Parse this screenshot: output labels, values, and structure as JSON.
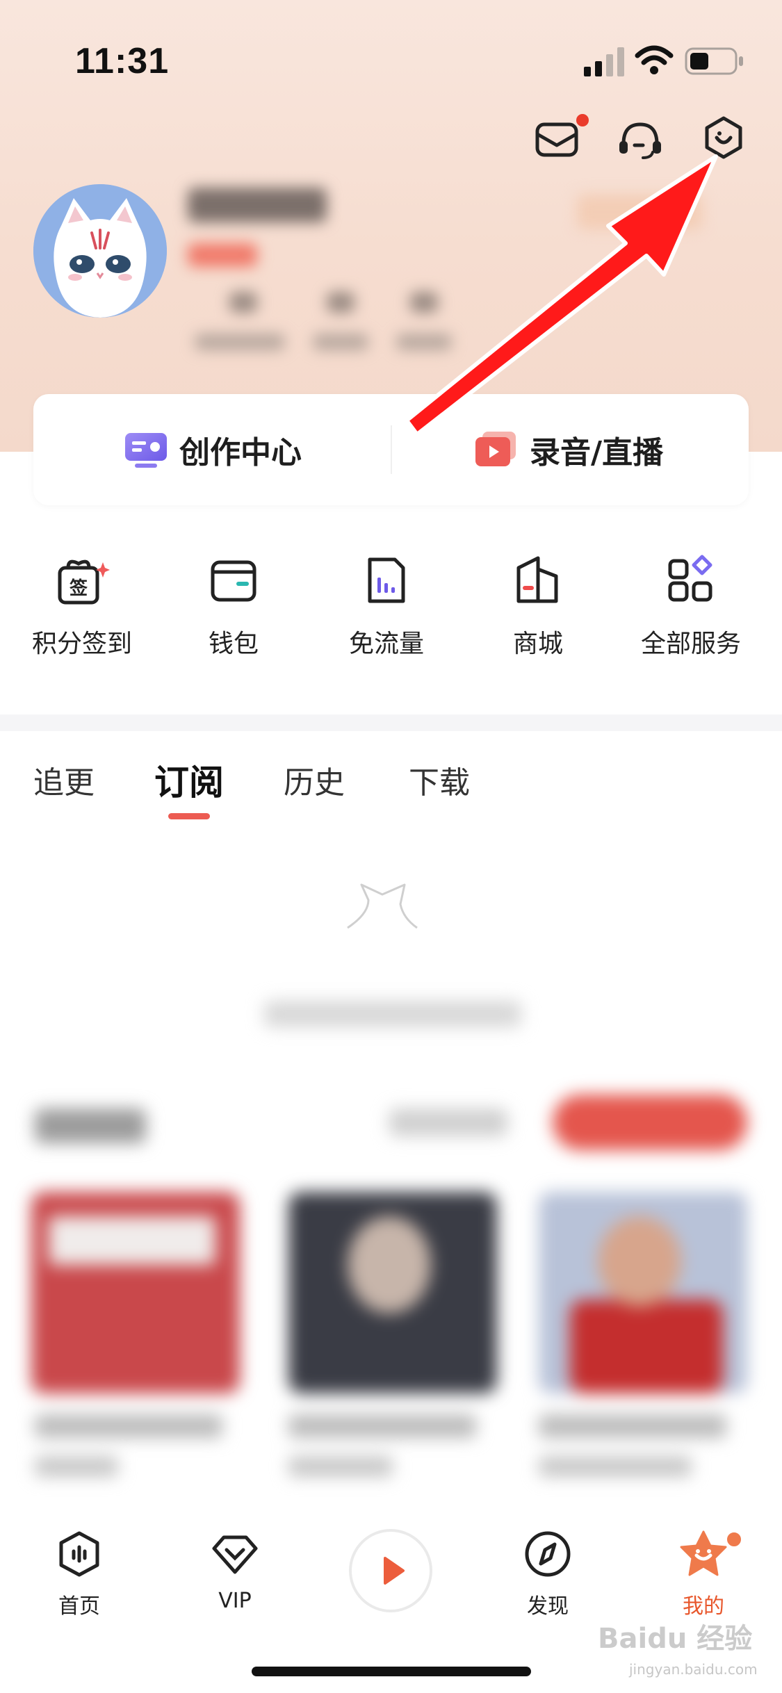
{
  "status_bar": {
    "time": "11:31"
  },
  "top_actions": {
    "mail_icon": "mail-icon",
    "support_icon": "headset-icon",
    "settings_icon": "settings-icon",
    "mail_badge": true
  },
  "creator_card": {
    "create_center_label": "创作中心",
    "record_live_label": "录音/直播"
  },
  "quick_services": [
    {
      "label": "积分签到",
      "icon": "sign-in-gift-icon",
      "icon_text": "签"
    },
    {
      "label": "钱包",
      "icon": "wallet-icon"
    },
    {
      "label": "免流量",
      "icon": "data-free-icon"
    },
    {
      "label": "商城",
      "icon": "mall-icon"
    },
    {
      "label": "全部服务",
      "icon": "all-services-icon"
    }
  ],
  "tabs": [
    {
      "label": "追更",
      "active": false
    },
    {
      "label": "订阅",
      "active": true
    },
    {
      "label": "历史",
      "active": false
    },
    {
      "label": "下载",
      "active": false
    }
  ],
  "bottom_nav": [
    {
      "label": "首页",
      "icon": "home-icon",
      "active": false
    },
    {
      "label": "VIP",
      "icon": "vip-icon",
      "active": false
    },
    {
      "label": "发现",
      "icon": "discover-icon",
      "active": false
    },
    {
      "label": "我的",
      "icon": "me-icon",
      "active": true
    }
  ],
  "colors": {
    "accent": "#e8572c",
    "tab_indicator": "#ec5b52",
    "header_bg": "#f6ddd0",
    "badge": "#ea3b2b",
    "annotation_arrow": "#ff1a1a"
  },
  "watermark": {
    "text": "Baidu 经验",
    "sub": "jingyan.baidu.com"
  }
}
